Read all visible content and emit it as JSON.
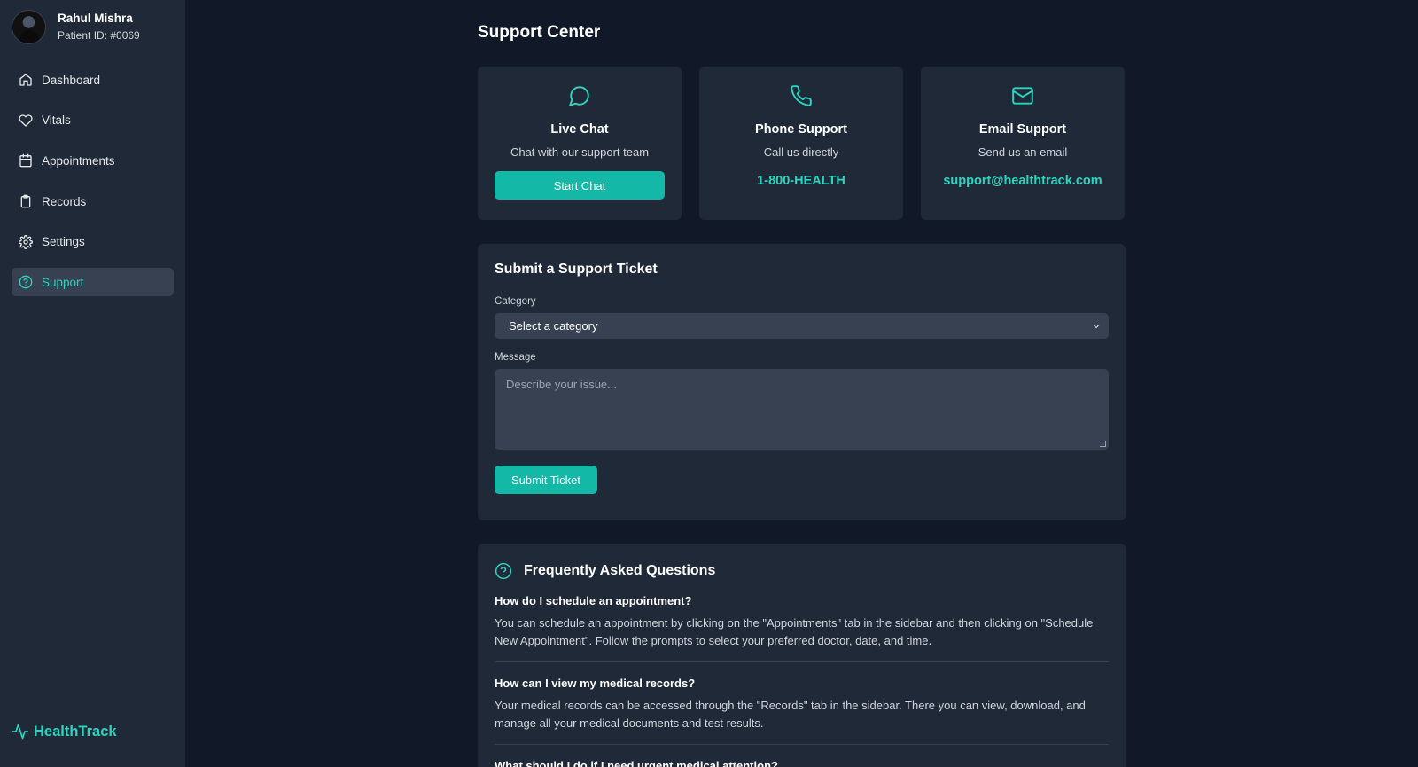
{
  "user": {
    "name": "Rahul Mishra",
    "patient_id": "Patient ID: #0069"
  },
  "sidebar": {
    "items": [
      {
        "label": "Dashboard",
        "icon": "home-icon"
      },
      {
        "label": "Vitals",
        "icon": "heart-icon"
      },
      {
        "label": "Appointments",
        "icon": "calendar-icon"
      },
      {
        "label": "Records",
        "icon": "clipboard-icon"
      },
      {
        "label": "Settings",
        "icon": "gear-icon"
      },
      {
        "label": "Support",
        "icon": "help-circle-icon",
        "active": true
      }
    ],
    "brand": "HealthTrack"
  },
  "page": {
    "title": "Support Center"
  },
  "cards": {
    "live_chat": {
      "title": "Live Chat",
      "subtitle": "Chat with our support team",
      "button": "Start Chat",
      "icon": "chat-bubble-icon"
    },
    "phone": {
      "title": "Phone Support",
      "subtitle": "Call us directly",
      "value": "1-800-HEALTH",
      "icon": "phone-icon"
    },
    "email": {
      "title": "Email Support",
      "subtitle": "Send us an email",
      "value": "support@healthtrack.com",
      "icon": "mail-icon"
    }
  },
  "ticket": {
    "title": "Submit a Support Ticket",
    "category_label": "Category",
    "category_value": "Select a category",
    "message_label": "Message",
    "message_placeholder": "Describe your issue...",
    "submit": "Submit Ticket"
  },
  "faq": {
    "title": "Frequently Asked Questions",
    "items": [
      {
        "q": "How do I schedule an appointment?",
        "a": "You can schedule an appointment by clicking on the \"Appointments\" tab in the sidebar and then clicking on \"Schedule New Appointment\". Follow the prompts to select your preferred doctor, date, and time."
      },
      {
        "q": "How can I view my medical records?",
        "a": "Your medical records can be accessed through the \"Records\" tab in the sidebar. There you can view, download, and manage all your medical documents and test results."
      },
      {
        "q": "What should I do if I need urgent medical attention?",
        "a": ""
      }
    ]
  },
  "colors": {
    "accent": "#2dd4bf",
    "button": "#14b8a6",
    "background": "#111827",
    "panel": "#1f2937"
  }
}
